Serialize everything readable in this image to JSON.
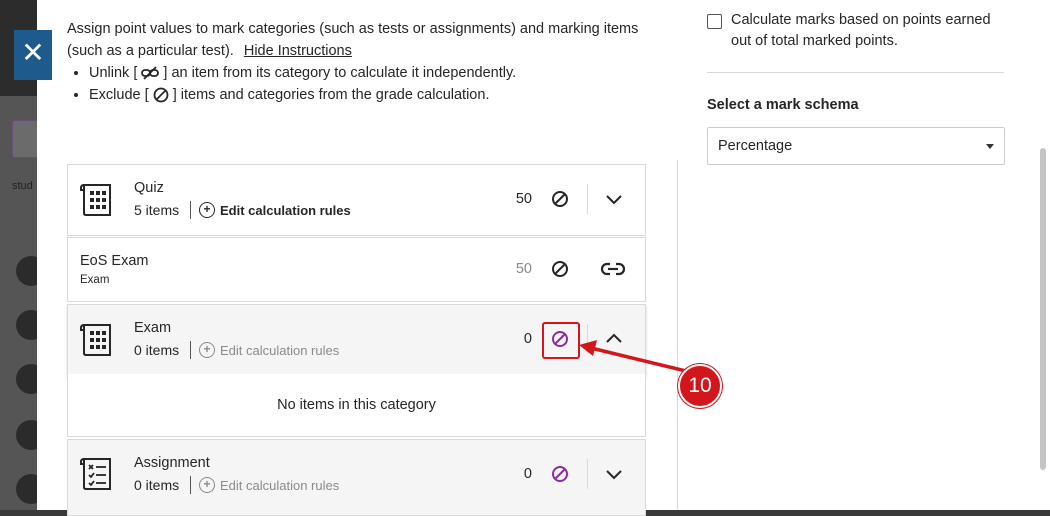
{
  "close_label": "✕",
  "background": {
    "partial_text": "stud"
  },
  "instructions": {
    "intro": "Assign point values to mark categories (such as tests or assignments) and marking items (such as a particular test).",
    "hide_link": "Hide Instructions",
    "bullet1_pre": "Unlink [",
    "bullet1_post": "] an item from its category to calculate it independently.",
    "bullet2_pre": "Exclude [",
    "bullet2_post": "] items and categories from the grade calculation."
  },
  "settings": {
    "calc_checkbox_label": "Calculate marks based on points earned out of total marked points.",
    "calc_checked": false,
    "schema_label": "Select a mark schema",
    "schema_value": "Percentage"
  },
  "categories": [
    {
      "title": "Quiz",
      "count": "5 items",
      "edit_label": "Edit calculation rules",
      "points": "50"
    },
    {
      "title": "EoS Exam",
      "subtitle": "Exam",
      "points": "50"
    },
    {
      "title": "Exam",
      "count": "0 items",
      "edit_label": "Edit calculation rules",
      "points": "0",
      "empty_note": "No items in this category"
    },
    {
      "title": "Assignment",
      "count": "0 items",
      "edit_label": "Edit calculation rules",
      "points": "0"
    }
  ],
  "callout_number": "10",
  "colors": {
    "accent_purple": "#8a2d9e",
    "callout_red": "#d3161c",
    "close_blue": "#1f5a8c"
  }
}
